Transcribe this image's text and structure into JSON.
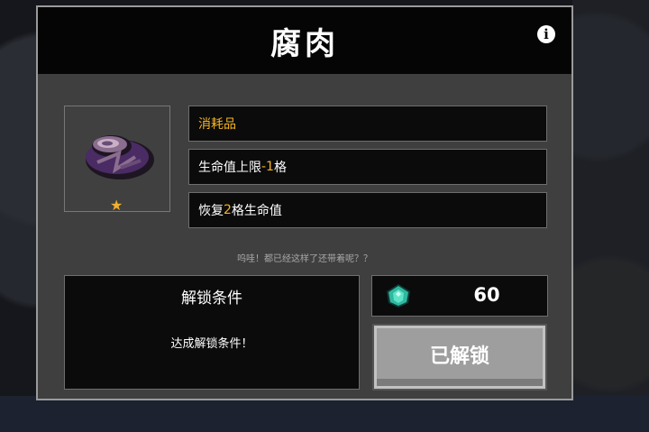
{
  "dialog": {
    "title": "腐肉",
    "info_icon": "i"
  },
  "item": {
    "icon": "rotten-meat-icon",
    "rarity": "★"
  },
  "stats": {
    "type": "消耗品",
    "line2_prefix": "生命值上限",
    "line2_value": "-1",
    "line2_suffix": "格",
    "line3_prefix": "恢复",
    "line3_value": "2",
    "line3_suffix": "格生命值"
  },
  "quote": "呜哇！都已经这样了还带着呢？？",
  "unlock": {
    "title": "解锁条件",
    "desc": "达成解锁条件！"
  },
  "cost": {
    "icon": "gem-icon",
    "value": "60"
  },
  "status_button": "已解锁",
  "colors": {
    "highlight": "#f5b521",
    "panel": "#0b0b0b",
    "dialog": "#3f3f3f"
  }
}
